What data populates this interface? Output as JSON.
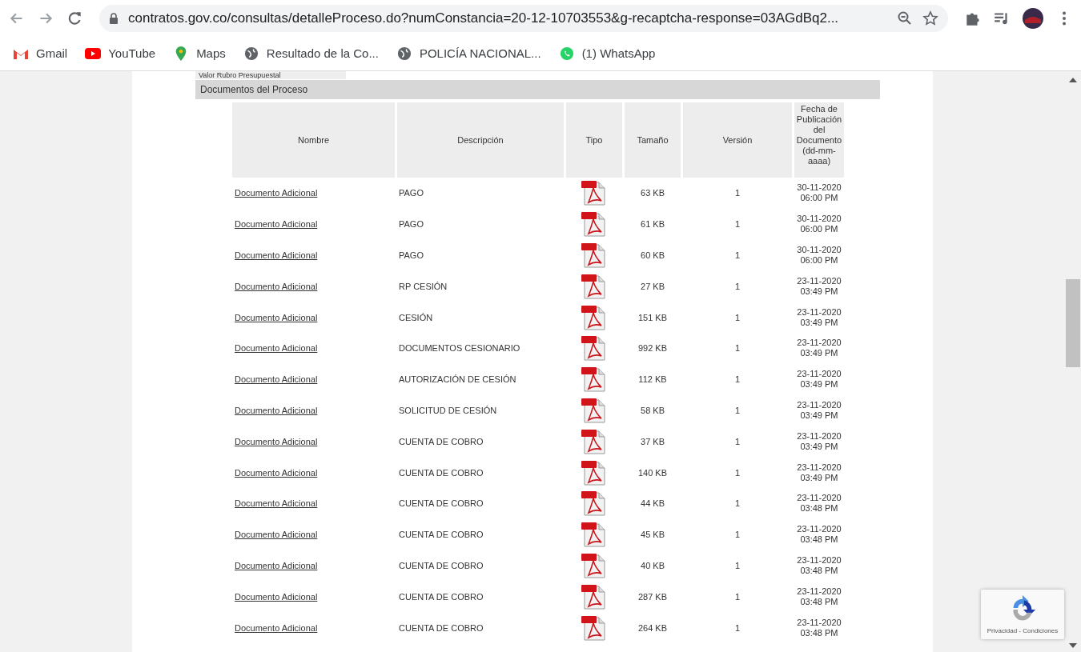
{
  "browser": {
    "url": "contratos.gov.co/consultas/detalleProceso.do?numConstancia=20-12-10703553&g-recaptcha-response=03AGdBq2...",
    "bookmarks": [
      {
        "label": "Gmail",
        "kind": "gmail"
      },
      {
        "label": "YouTube",
        "kind": "youtube"
      },
      {
        "label": "Maps",
        "kind": "maps"
      },
      {
        "label": "Resultado de la Co...",
        "kind": "globe"
      },
      {
        "label": "POLICÍA NACIONAL...",
        "kind": "globe"
      },
      {
        "label": "(1) WhatsApp",
        "kind": "whatsapp"
      }
    ]
  },
  "previous_field": "Valor Rubro Presupuestal",
  "section_title": "Documentos del Proceso",
  "table": {
    "columns": [
      "Nombre",
      "Descripción",
      "Tipo",
      "Tamaño",
      "Versión",
      "Fecha de Publicación del Documento (dd-mm-aaaa)"
    ],
    "rows": [
      {
        "name": "Documento Adicional",
        "description": "PAGO",
        "size": "63 KB",
        "version": "1",
        "date": "30-11-2020",
        "time": "06:00 PM"
      },
      {
        "name": "Documento Adicional",
        "description": "PAGO",
        "size": "61 KB",
        "version": "1",
        "date": "30-11-2020",
        "time": "06:00 PM"
      },
      {
        "name": "Documento Adicional",
        "description": "PAGO",
        "size": "60 KB",
        "version": "1",
        "date": "30-11-2020",
        "time": "06:00 PM"
      },
      {
        "name": "Documento Adicional",
        "description": "RP CESIÓN",
        "size": "27 KB",
        "version": "1",
        "date": "23-11-2020",
        "time": "03:49 PM"
      },
      {
        "name": "Documento Adicional",
        "description": "CESIÓN",
        "size": "151 KB",
        "version": "1",
        "date": "23-11-2020",
        "time": "03:49 PM"
      },
      {
        "name": "Documento Adicional",
        "description": "DOCUMENTOS CESIONARIO",
        "size": "992 KB",
        "version": "1",
        "date": "23-11-2020",
        "time": "03:49 PM"
      },
      {
        "name": "Documento Adicional",
        "description": "AUTORIZACIÓN DE CESIÓN",
        "size": "112 KB",
        "version": "1",
        "date": "23-11-2020",
        "time": "03:49 PM"
      },
      {
        "name": "Documento Adicional",
        "description": "SOLICITUD DE CESIÓN",
        "size": "58 KB",
        "version": "1",
        "date": "23-11-2020",
        "time": "03:49 PM"
      },
      {
        "name": "Documento Adicional",
        "description": "CUENTA DE COBRO",
        "size": "37 KB",
        "version": "1",
        "date": "23-11-2020",
        "time": "03:49 PM"
      },
      {
        "name": "Documento Adicional",
        "description": "CUENTA DE COBRO",
        "size": "140 KB",
        "version": "1",
        "date": "23-11-2020",
        "time": "03:49 PM"
      },
      {
        "name": "Documento Adicional",
        "description": "CUENTA DE COBRO",
        "size": "44 KB",
        "version": "1",
        "date": "23-11-2020",
        "time": "03:48 PM"
      },
      {
        "name": "Documento Adicional",
        "description": "CUENTA DE COBRO",
        "size": "45 KB",
        "version": "1",
        "date": "23-11-2020",
        "time": "03:48 PM"
      },
      {
        "name": "Documento Adicional",
        "description": "CUENTA DE COBRO",
        "size": "40 KB",
        "version": "1",
        "date": "23-11-2020",
        "time": "03:48 PM"
      },
      {
        "name": "Documento Adicional",
        "description": "CUENTA DE COBRO",
        "size": "287 KB",
        "version": "1",
        "date": "23-11-2020",
        "time": "03:48 PM"
      },
      {
        "name": "Documento Adicional",
        "description": "CUENTA DE COBRO",
        "size": "264 KB",
        "version": "1",
        "date": "23-11-2020",
        "time": "03:48 PM"
      }
    ]
  },
  "recaptcha": {
    "links": "Privacidad - Condiciones"
  }
}
